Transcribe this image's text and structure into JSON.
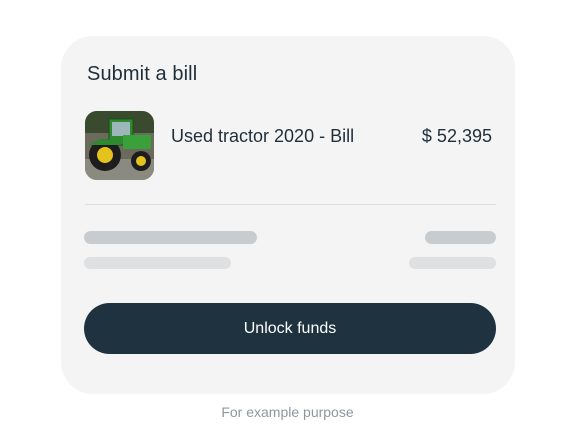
{
  "card": {
    "title": "Submit a bill",
    "bill": {
      "name": "Used tractor 2020 - Bill",
      "amount": "$ 52,395",
      "thumbnail_icon": "tractor-image"
    },
    "button_label": "Unlock funds"
  },
  "footnote": "For example purpose",
  "colors": {
    "card_bg": "#f5f4f4",
    "button_bg": "#1e3240",
    "text_dark": "#1e2f3b",
    "skeleton_dark": "#c9cccf",
    "skeleton_light": "#dee0e2",
    "footnote": "#8f979e"
  }
}
